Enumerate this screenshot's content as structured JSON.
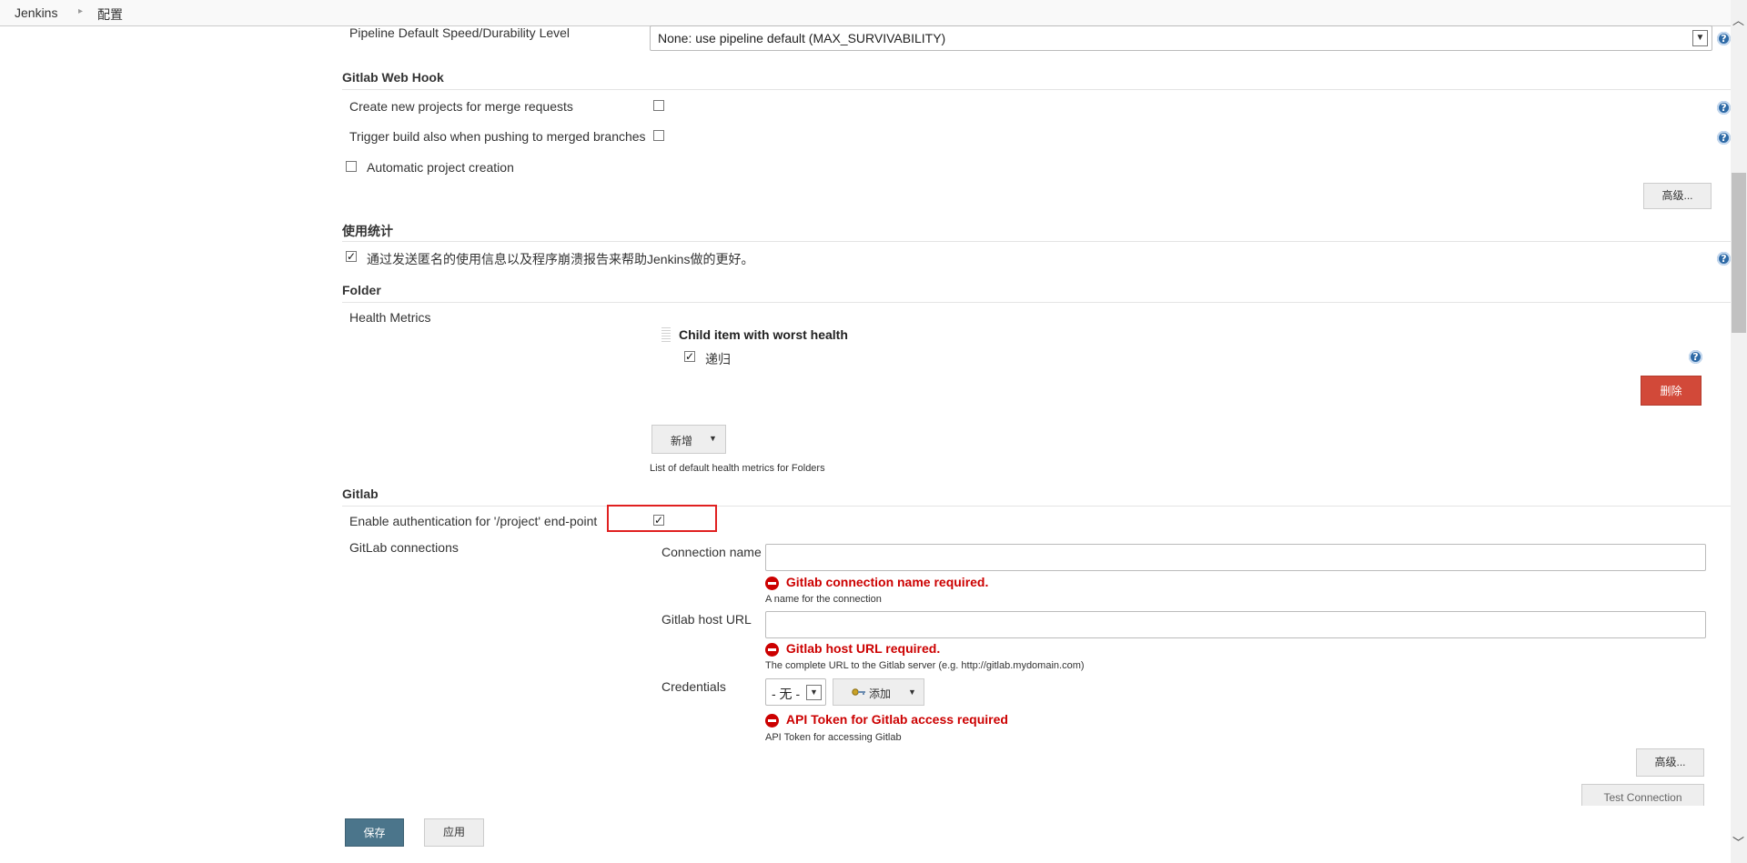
{
  "breadcrumb": {
    "items": [
      "Jenkins",
      "配置"
    ]
  },
  "pipeline": {
    "label": "Pipeline Default Speed/Durability Level",
    "selected": "None: use pipeline default (MAX_SURVIVABILITY)"
  },
  "gitlab_webhook": {
    "title": "Gitlab Web Hook",
    "create_projects_label": "Create new projects for merge requests",
    "trigger_build_label": "Trigger build also when pushing to merged branches",
    "auto_creation_label": "Automatic project creation",
    "advanced_label": "高级..."
  },
  "usage_stats": {
    "title": "使用统计",
    "checkbox_label": "通过发送匿名的使用信息以及程序崩溃报告来帮助Jenkins做的更好。"
  },
  "folder": {
    "title": "Folder",
    "health_metrics_label": "Health Metrics",
    "metric_title": "Child item with worst health",
    "recursive_label": "递归",
    "delete_label": "删除",
    "add_label": "新增",
    "description": "List of default health metrics for Folders"
  },
  "gitlab": {
    "title": "Gitlab",
    "enable_auth_label": "Enable authentication for '/project' end-point",
    "connections_label": "GitLab connections",
    "connection_name_label": "Connection name",
    "connection_name_value": "",
    "connection_name_error": "Gitlab connection name required.",
    "connection_name_desc": "A name for the connection",
    "host_url_label": "Gitlab host URL",
    "host_url_value": "",
    "host_url_error": "Gitlab host URL required.",
    "host_url_desc": "The complete URL to the Gitlab server (e.g. http://gitlab.mydomain.com)",
    "credentials_label": "Credentials",
    "credentials_selected": "- 无 -",
    "credentials_add_label": "添加",
    "api_token_error": "API Token for Gitlab access required",
    "api_token_desc": "API Token for accessing Gitlab",
    "advanced_label": "高级...",
    "test_connection_label": "Test Connection"
  },
  "footer": {
    "save_label": "保存",
    "apply_label": "应用"
  },
  "colors": {
    "primary": "#4b758b",
    "danger": "#d24939",
    "error": "#cc0000",
    "highlight": "#e02020"
  },
  "help_glyph": "?"
}
